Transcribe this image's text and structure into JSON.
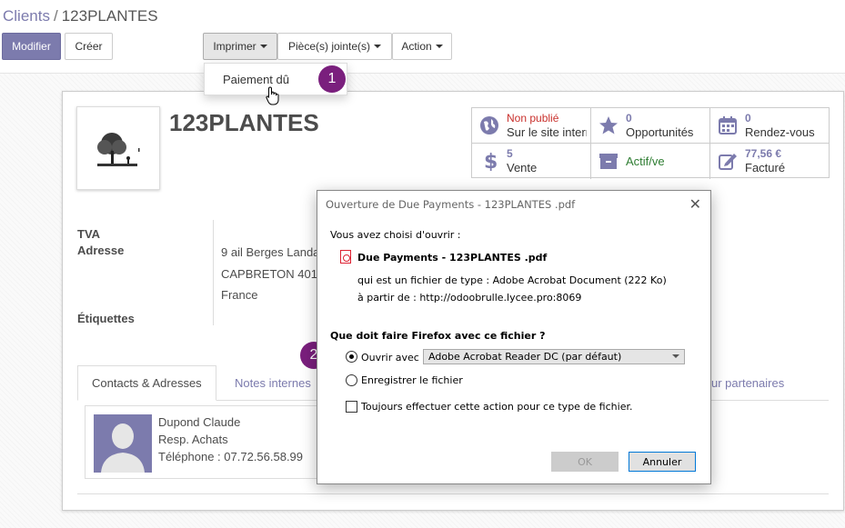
{
  "breadcrumb": {
    "parent": "Clients",
    "separator": "/",
    "current": "123PLANTES"
  },
  "toolbar": {
    "edit_label": "Modifier",
    "create_label": "Créer",
    "print_label": "Imprimer",
    "attachments_label": "Pièce(s) jointe(s)",
    "action_label": "Action"
  },
  "print_menu": {
    "items": [
      "Paiement dû"
    ]
  },
  "annotations": {
    "step1": "1",
    "step2": "2"
  },
  "partner": {
    "name": "123PLANTES"
  },
  "stats": [
    {
      "value": "Non publié",
      "label": "Sur le site internet",
      "icon": "globe-icon"
    },
    {
      "value": "0",
      "label": "Opportunités",
      "icon": "star-icon"
    },
    {
      "value": "0",
      "label": "Rendez-vous",
      "icon": "calendar-icon"
    },
    {
      "value": "5",
      "label": "Vente",
      "icon": "dollar-icon"
    },
    {
      "value": "",
      "label": "Actif/ve",
      "icon": "archive-icon"
    },
    {
      "value": "77,56 €",
      "label": "Facturé",
      "icon": "invoice-edit-icon"
    }
  ],
  "fields": {
    "tva_label": "TVA",
    "address_label": "Adresse",
    "tags_label": "Étiquettes",
    "address_lines": [
      "9 ail Berges Landa",
      "CAPBRETON 401",
      "France"
    ]
  },
  "tabs": [
    {
      "label": "Contacts & Adresses"
    },
    {
      "label": "Notes internes"
    },
    {
      "label": "ur partenaires"
    }
  ],
  "contact": {
    "name": "Dupond Claude",
    "role": "Resp. Achats",
    "phone": "Téléphone : 07.72.56.58.99"
  },
  "dialog": {
    "title": "Ouverture de Due Payments - 123PLANTES .pdf",
    "intro": "Vous avez choisi d'ouvrir :",
    "filename": "Due Payments - 123PLANTES .pdf",
    "filetype": "qui est un fichier de type :  Adobe Acrobat Document (222 Ko)",
    "source": "à partir de :  http://odoobrulle.lycee.pro:8069",
    "question": "Que doit faire Firefox avec ce fichier ?",
    "open_with_label": "Ouvrir avec",
    "open_with_value": "Adobe Acrobat Reader DC (par défaut)",
    "save_label": "Enregistrer le fichier",
    "always_label": "Toujours effectuer cette action pour ce type de fichier.",
    "ok_label": "OK",
    "cancel_label": "Annuler"
  }
}
